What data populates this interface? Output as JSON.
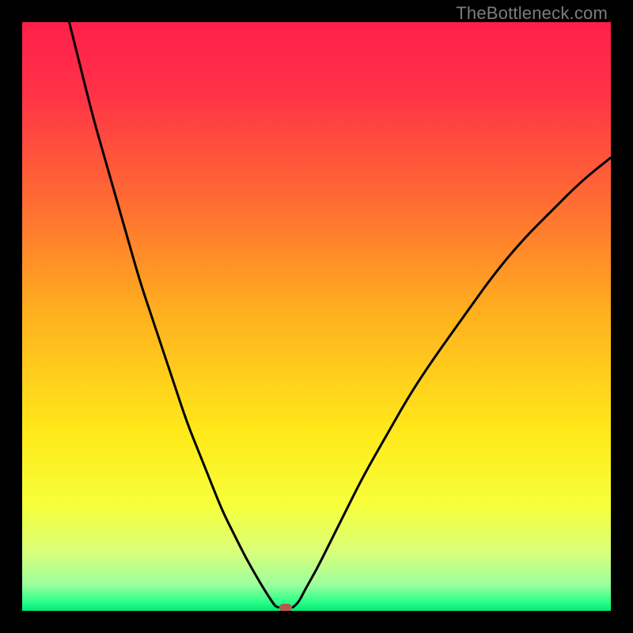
{
  "watermark": {
    "text": "TheBottleneck.com"
  },
  "chart_data": {
    "type": "line",
    "title": "",
    "xlabel": "",
    "ylabel": "",
    "xlim": [
      0,
      100
    ],
    "ylim": [
      0,
      100
    ],
    "grid": false,
    "series": [
      {
        "name": "left-curve",
        "x": [
          8,
          10,
          12,
          14,
          16,
          18,
          20,
          22,
          24,
          26,
          28,
          30,
          32,
          34,
          36,
          38,
          40,
          41.5,
          42.5,
          43,
          43.5
        ],
        "y": [
          100,
          92,
          84,
          77,
          70,
          63,
          56,
          50,
          44,
          38,
          32,
          27,
          22,
          17,
          13,
          9,
          5.5,
          3,
          1.5,
          0.8,
          0.6
        ]
      },
      {
        "name": "right-curve",
        "x": [
          46,
          47,
          48,
          50,
          52,
          55,
          58,
          62,
          66,
          70,
          75,
          80,
          85,
          90,
          95,
          100
        ],
        "y": [
          0.6,
          1.5,
          3.5,
          7,
          11,
          17,
          23,
          30,
          37,
          43,
          50,
          57,
          63,
          68,
          73,
          77
        ]
      }
    ],
    "marker": {
      "x": 44.8,
      "y": 0.6,
      "color": "#b55a4a"
    },
    "gradient_stops": [
      {
        "pos": 0,
        "color": "#ff1f4a"
      },
      {
        "pos": 0.12,
        "color": "#ff3247"
      },
      {
        "pos": 0.3,
        "color": "#ff6a33"
      },
      {
        "pos": 0.5,
        "color": "#ffb21e"
      },
      {
        "pos": 0.7,
        "color": "#ffea1a"
      },
      {
        "pos": 0.82,
        "color": "#f7ff3a"
      },
      {
        "pos": 0.9,
        "color": "#d9ff7a"
      },
      {
        "pos": 0.955,
        "color": "#9dff9d"
      },
      {
        "pos": 0.985,
        "color": "#2bff88"
      },
      {
        "pos": 1.0,
        "color": "#00e877"
      }
    ]
  }
}
